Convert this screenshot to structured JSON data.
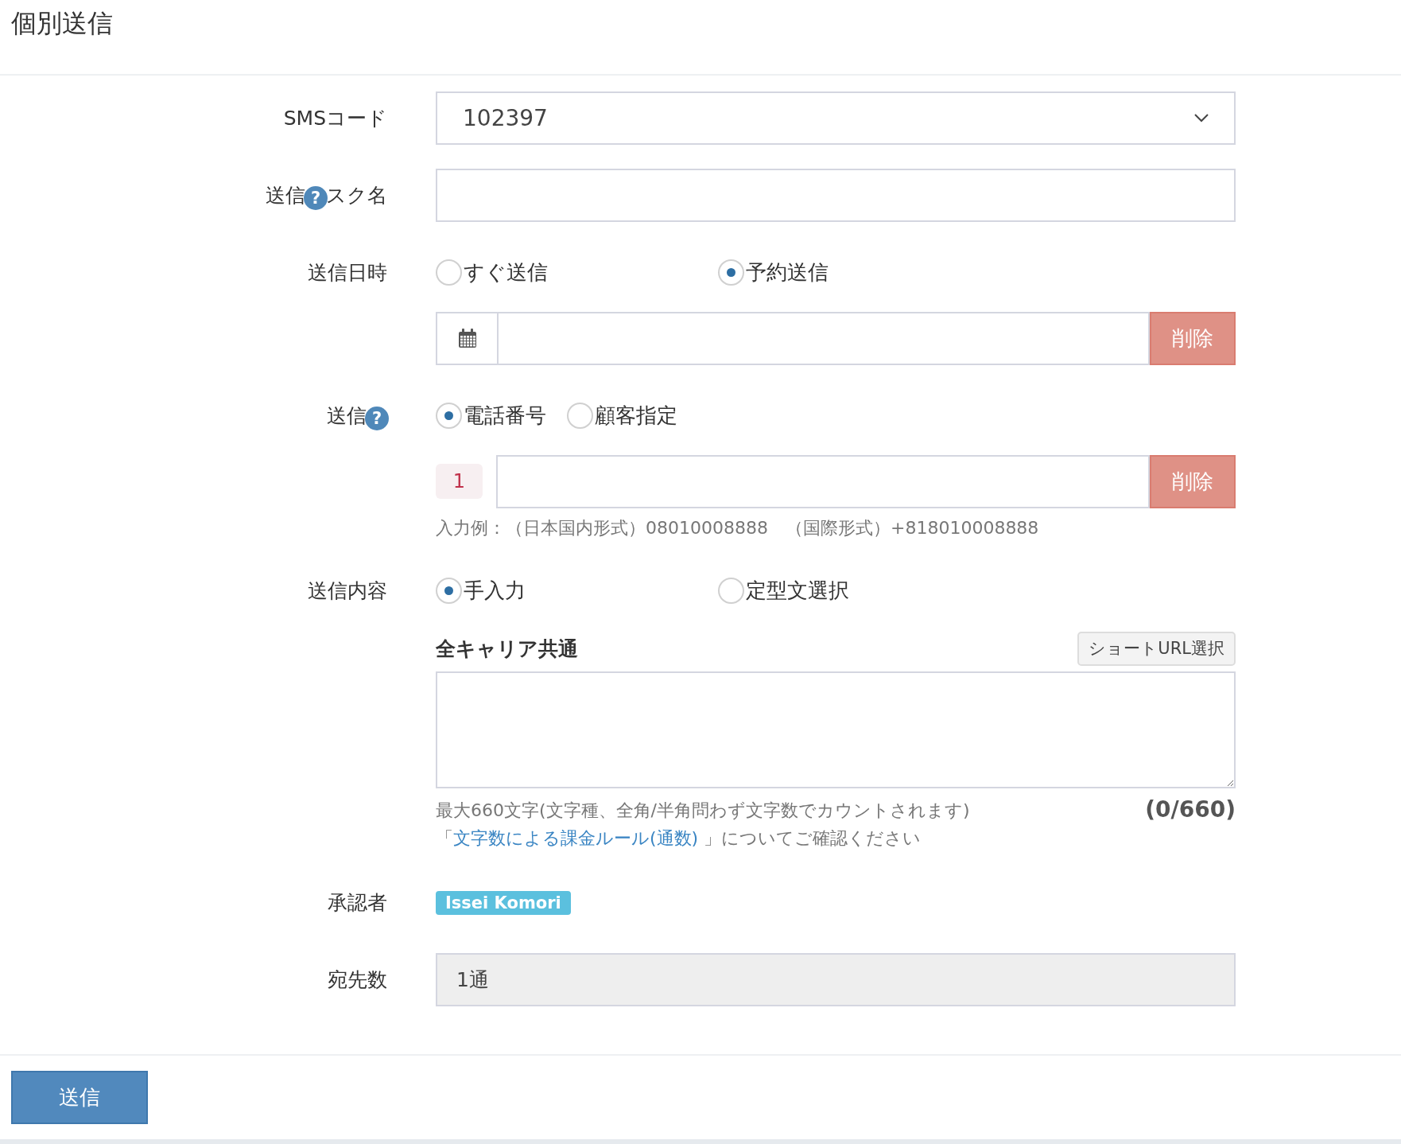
{
  "header": {
    "title": "個別送信"
  },
  "rows": [
    {
      "kind": "select",
      "label": "SMSコード",
      "value": "102397"
    },
    {
      "kind": "text",
      "label": "送信",
      "help": "?",
      "label_after_help": "スク名"
    },
    {
      "kind": "schedule",
      "label": "送信日時",
      "options": [
        {
          "label": "すぐ送信",
          "selected": false
        },
        {
          "label": "予約送信",
          "selected": true
        }
      ],
      "delete_button": "削除"
    },
    {
      "kind": "recipient",
      "label": "送信",
      "help": "?",
      "options": [
        {
          "label": "電話番号",
          "selected": true
        },
        {
          "label": "顧客指定",
          "selected": false
        }
      ],
      "index": "1",
      "delete_button": "削除",
      "hint": "入力例：（日本国内形式）08010008888　（国際形式）+818010008888"
    },
    {
      "kind": "content",
      "label": "送信内容",
      "options": [
        {
          "label": "手入力",
          "selected": true
        },
        {
          "label": "定型文選択",
          "selected": false
        }
      ],
      "heading": "全キャリア共通",
      "short_url_button": "ショートURL選択",
      "note": "最大660文字(文字種、全角/半角問わず文字数でカウントされます) 「",
      "link": "文字数による課金ルール(通数)",
      "note_after": "」についてご確認ください",
      "counter": "(0/660)"
    },
    {
      "kind": "badge",
      "label": "承認者",
      "value": "Issei Komori"
    },
    {
      "kind": "readonly",
      "label": "宛先数",
      "value": "1通"
    }
  ],
  "footer": {
    "submit_button": "送信"
  }
}
